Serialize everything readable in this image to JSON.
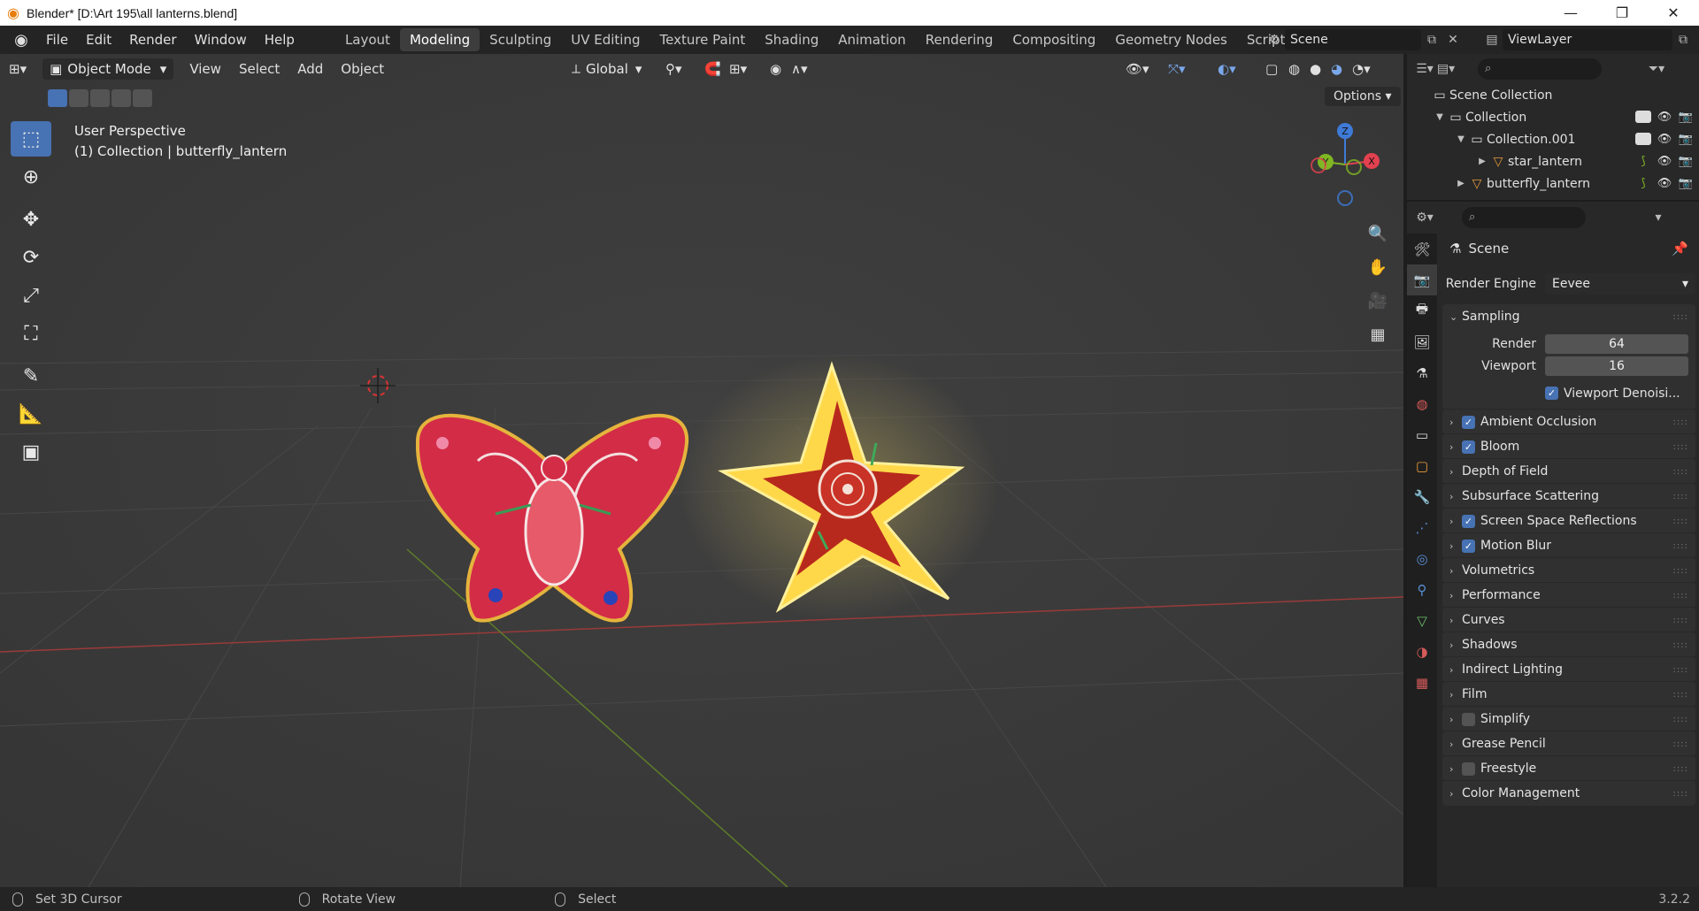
{
  "window": {
    "title": "Blender* [D:\\Art 195\\all lanterns.blend]",
    "controls": [
      "minimize",
      "restore",
      "close"
    ]
  },
  "topbar": {
    "menus": [
      "File",
      "Edit",
      "Render",
      "Window",
      "Help"
    ],
    "workspaces": [
      "Layout",
      "Modeling",
      "Sculpting",
      "UV Editing",
      "Texture Paint",
      "Shading",
      "Animation",
      "Rendering",
      "Compositing",
      "Geometry Nodes",
      "Scripting"
    ],
    "active_workspace": "Modeling",
    "scene": "Scene",
    "view_layer": "ViewLayer"
  },
  "viewport": {
    "mode": "Object Mode",
    "menus": [
      "View",
      "Select",
      "Add",
      "Object"
    ],
    "orientation": "Global",
    "options_label": "Options",
    "info_line1": "User Perspective",
    "info_line2": "(1) Collection | butterfly_lantern",
    "gizmo_labels": {
      "z": "Z",
      "y": "Y",
      "x": "X"
    }
  },
  "outliner": {
    "rows": [
      {
        "label": "Scene Collection"
      },
      {
        "label": "Collection"
      },
      {
        "label": "Collection.001"
      },
      {
        "label": "star_lantern"
      },
      {
        "label": "butterfly_lantern"
      }
    ]
  },
  "properties": {
    "context": "Scene",
    "render_engine_label": "Render Engine",
    "render_engine": "Eevee",
    "sampling": {
      "title": "Sampling",
      "render_label": "Render",
      "render_value": "64",
      "viewport_label": "Viewport",
      "viewport_value": "16",
      "denoise_label": "Viewport Denoisi..."
    },
    "panels": [
      {
        "label": "Ambient Occlusion",
        "checkbox": "on"
      },
      {
        "label": "Bloom",
        "checkbox": "on"
      },
      {
        "label": "Depth of Field",
        "checkbox": "none"
      },
      {
        "label": "Subsurface Scattering",
        "checkbox": "none"
      },
      {
        "label": "Screen Space Reflections",
        "checkbox": "on"
      },
      {
        "label": "Motion Blur",
        "checkbox": "on"
      },
      {
        "label": "Volumetrics",
        "checkbox": "none"
      },
      {
        "label": "Performance",
        "checkbox": "none"
      },
      {
        "label": "Curves",
        "checkbox": "none"
      },
      {
        "label": "Shadows",
        "checkbox": "none"
      },
      {
        "label": "Indirect Lighting",
        "checkbox": "none"
      },
      {
        "label": "Film",
        "checkbox": "none"
      },
      {
        "label": "Simplify",
        "checkbox": "off"
      },
      {
        "label": "Grease Pencil",
        "checkbox": "none"
      },
      {
        "label": "Freestyle",
        "checkbox": "off"
      },
      {
        "label": "Color Management",
        "checkbox": "none"
      }
    ]
  },
  "statusbar": {
    "hint1": "Set 3D Cursor",
    "hint2": "Rotate View",
    "hint3": "Select",
    "version": "3.2.2"
  },
  "colors": {
    "accent": "#4772b3",
    "axis_x": "#e2414f",
    "axis_y": "#7fb623",
    "axis_z": "#3e7ad6"
  }
}
